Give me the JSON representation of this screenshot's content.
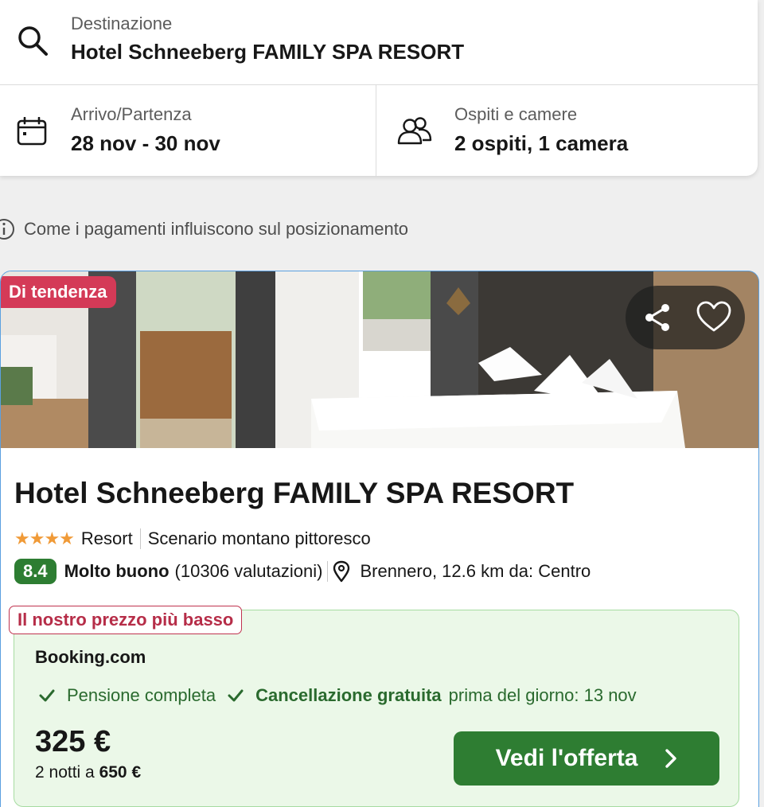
{
  "search": {
    "destination_label": "Destinazione",
    "destination_value": "Hotel Schneeberg FAMILY SPA RESORT",
    "dates_label": "Arrivo/Partenza",
    "dates_value": "28 nov - 30 nov",
    "guests_label": "Ospiti e camere",
    "guests_value": "2 ospiti, 1 camera"
  },
  "disclaimer": "Come i pagamenti influiscono sul posizionamento",
  "hotel": {
    "trend_badge": "Di tendenza",
    "name": "Hotel Schneeberg FAMILY SPA RESORT",
    "stars": "★★★★",
    "type": "Resort",
    "feature": "Scenario montano pittoresco",
    "score": "8.4",
    "rating_text": "Molto buono",
    "reviews": "(10306 valutazioni)",
    "location": "Brennero, 12.6 km da: Centro"
  },
  "offer": {
    "badge": "Il nostro prezzo più basso",
    "provider": "Booking.com",
    "board": "Pensione completa",
    "cancel_bold": "Cancellazione gratuita",
    "cancel_rest": "prima del giorno: 13 nov",
    "price": "325 €",
    "nights_prefix": "2 notti a",
    "total": "650 €",
    "cta_label": "Vedi l'offerta"
  },
  "colors": {
    "accent_green": "#2e7d32",
    "score_green": "#2d7d32",
    "trend_red": "#d43a57",
    "card_border": "#5ba0e0",
    "offer_bg": "#ebf8e8",
    "star_orange": "#f09a37"
  },
  "icons": {
    "search": "search-icon",
    "calendar": "calendar-icon",
    "guests": "users-icon",
    "info": "info-icon",
    "share": "share-icon",
    "favorite": "heart-icon",
    "location": "map-pin-icon",
    "check": "check-icon",
    "chevron": "chevron-right-icon"
  }
}
